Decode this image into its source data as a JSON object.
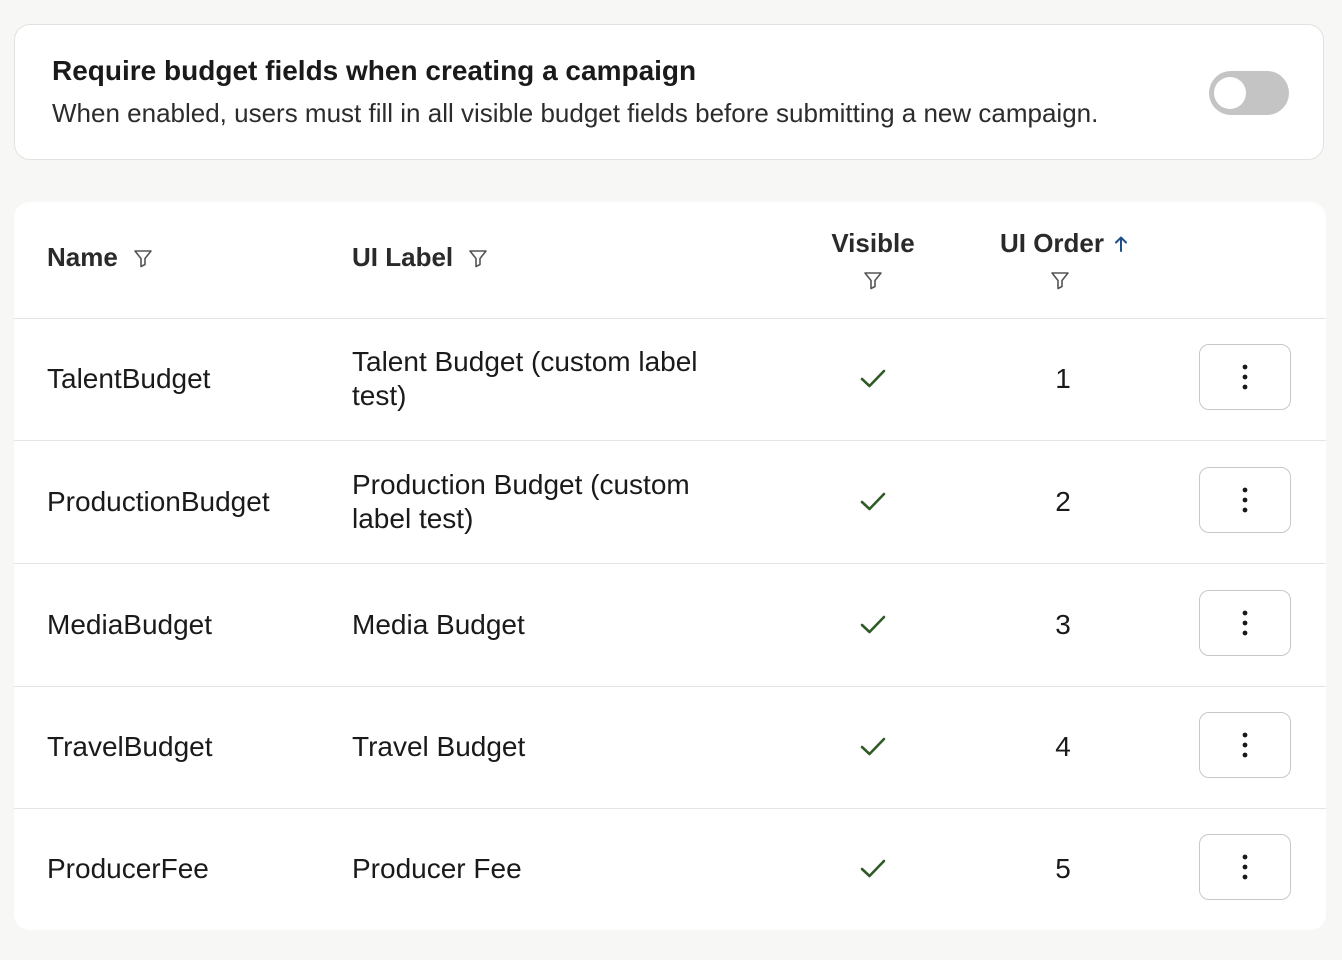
{
  "setting": {
    "title": "Require budget fields when creating a campaign",
    "description": "When enabled, users must fill in all visible budget fields before submitting a new campaign.",
    "toggle_enabled": false
  },
  "table": {
    "columns": {
      "name": "Name",
      "ui_label": "UI Label",
      "visible": "Visible",
      "ui_order": "UI Order"
    },
    "sort": {
      "column": "ui_order",
      "direction": "ascending"
    },
    "rows": [
      {
        "name": "TalentBudget",
        "ui_label": "Talent Budget (custom label test)",
        "visible": true,
        "ui_order": "1"
      },
      {
        "name": "ProductionBudget",
        "ui_label": "Production Budget (custom label test)",
        "visible": true,
        "ui_order": "2"
      },
      {
        "name": "MediaBudget",
        "ui_label": "Media Budget",
        "visible": true,
        "ui_order": "3"
      },
      {
        "name": "TravelBudget",
        "ui_label": "Travel Budget",
        "visible": true,
        "ui_order": "4"
      },
      {
        "name": "ProducerFee",
        "ui_label": "Producer Fee",
        "visible": true,
        "ui_order": "5"
      }
    ]
  },
  "icons": {
    "filter": "filter-icon",
    "sort": "arrow-up-icon",
    "visible": "check-icon",
    "menu": "more-vertical-icon"
  },
  "colors": {
    "check": "#2f5b26",
    "sort_arrow": "#1f4f8a",
    "toggle_off": "#c4c4c4"
  }
}
